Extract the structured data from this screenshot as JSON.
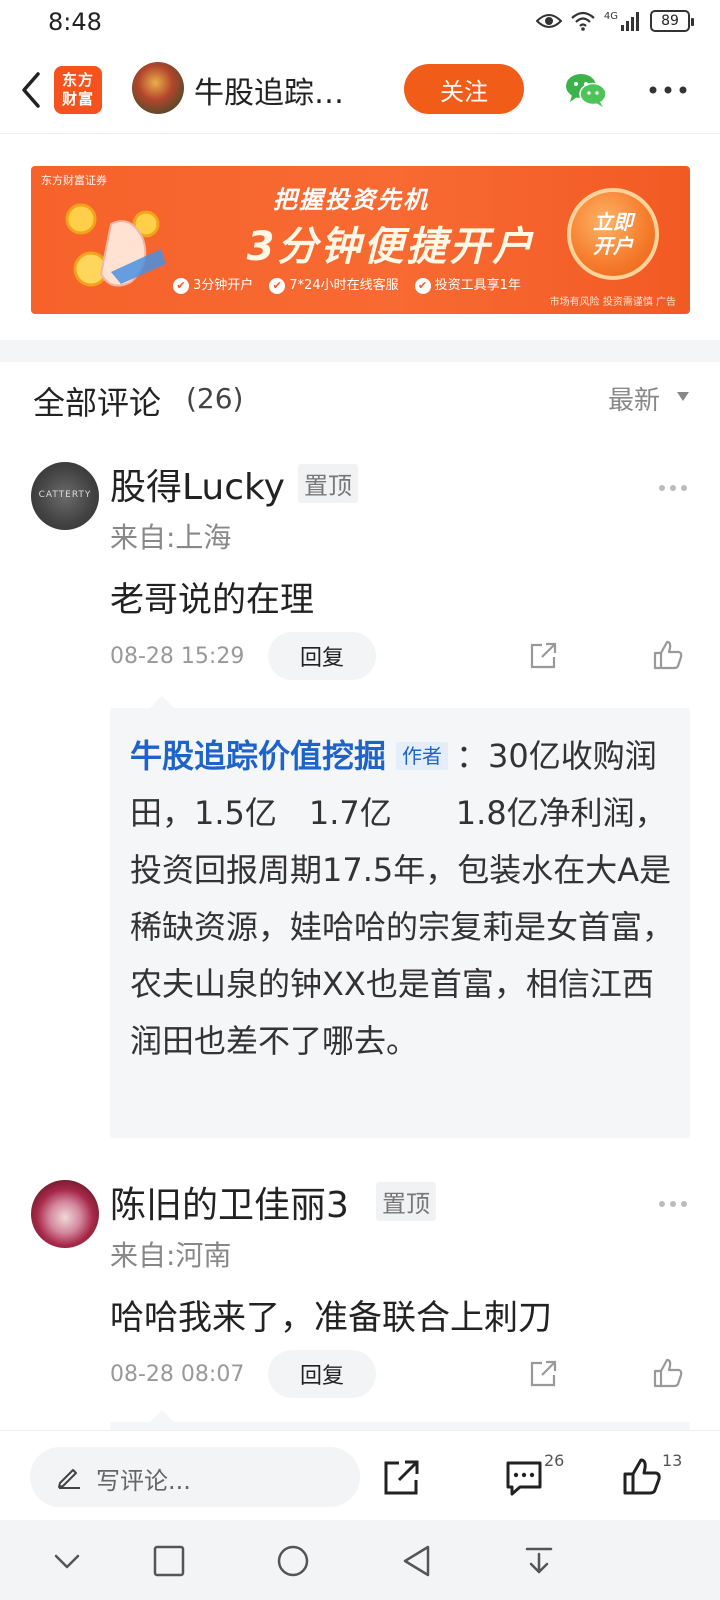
{
  "status": {
    "time": "8:48",
    "network": "4G",
    "battery": "89"
  },
  "header": {
    "app_logo": "东方\n财富",
    "author_name": "牛股追踪…",
    "follow_label": "关注"
  },
  "ad": {
    "brand": "东方财富证券",
    "title": "把握投资先机",
    "headline": "3分钟便捷开户",
    "features": [
      "3分钟开户",
      "7*24小时在线客服",
      "投资工具享1年"
    ],
    "cta": "立即\n开户",
    "disclaimer": "市场有风险 投资需谨慎 广告"
  },
  "comments_section": {
    "title": "全部评论",
    "count": "(26)",
    "sort_label": "最新"
  },
  "comments": [
    {
      "user": "股得Lucky",
      "badge": "置顶",
      "location": "来自:上海",
      "text": "老哥说的在理",
      "time": "08-28 15:29",
      "reply_label": "回复",
      "reply": {
        "author": "牛股追踪价值挖掘",
        "author_tag": "作者",
        "text": "：30亿收购润田，1.5亿　1.7亿　　1.8亿净利润，投资回报周期17.5年，包装水在大A是稀缺资源，娃哈哈的宗复莉是女首富，农夫山泉的钟XX也是首富，相信江西润田也差不了哪去。"
      }
    },
    {
      "user": "陈旧的卫佳丽3",
      "badge": "置顶",
      "location": "来自:河南",
      "text": "哈哈我来了，准备联合上刺刀",
      "time": "08-28 08:07",
      "reply_label": "回复"
    }
  ],
  "bottom_bar": {
    "input_placeholder": "写评论...",
    "comment_count": "26",
    "like_count": "13"
  },
  "colors": {
    "accent": "#f25c19",
    "author_link": "#1e63c9"
  }
}
